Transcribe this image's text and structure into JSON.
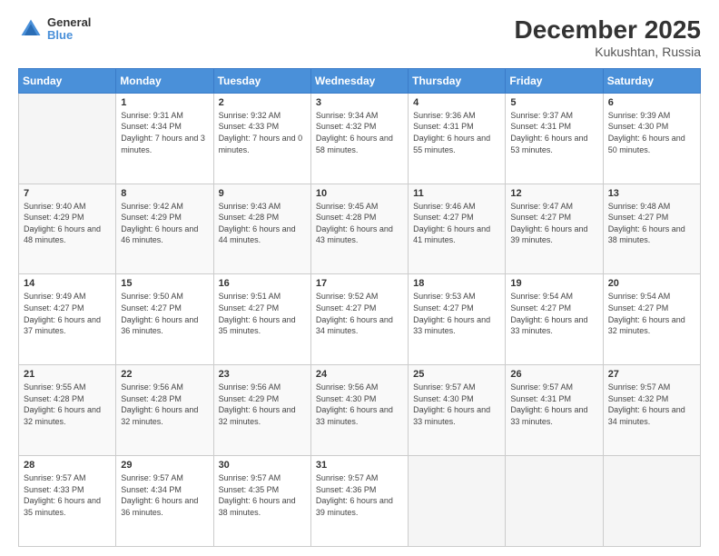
{
  "logo": {
    "text_top": "General",
    "text_bottom": "Blue"
  },
  "title": "December 2025",
  "subtitle": "Kukushtan, Russia",
  "days_header": [
    "Sunday",
    "Monday",
    "Tuesday",
    "Wednesday",
    "Thursday",
    "Friday",
    "Saturday"
  ],
  "weeks": [
    [
      {
        "day": "",
        "sunrise": "",
        "sunset": "",
        "daylight": ""
      },
      {
        "day": "1",
        "sunrise": "Sunrise: 9:31 AM",
        "sunset": "Sunset: 4:34 PM",
        "daylight": "Daylight: 7 hours and 3 minutes."
      },
      {
        "day": "2",
        "sunrise": "Sunrise: 9:32 AM",
        "sunset": "Sunset: 4:33 PM",
        "daylight": "Daylight: 7 hours and 0 minutes."
      },
      {
        "day": "3",
        "sunrise": "Sunrise: 9:34 AM",
        "sunset": "Sunset: 4:32 PM",
        "daylight": "Daylight: 6 hours and 58 minutes."
      },
      {
        "day": "4",
        "sunrise": "Sunrise: 9:36 AM",
        "sunset": "Sunset: 4:31 PM",
        "daylight": "Daylight: 6 hours and 55 minutes."
      },
      {
        "day": "5",
        "sunrise": "Sunrise: 9:37 AM",
        "sunset": "Sunset: 4:31 PM",
        "daylight": "Daylight: 6 hours and 53 minutes."
      },
      {
        "day": "6",
        "sunrise": "Sunrise: 9:39 AM",
        "sunset": "Sunset: 4:30 PM",
        "daylight": "Daylight: 6 hours and 50 minutes."
      }
    ],
    [
      {
        "day": "7",
        "sunrise": "Sunrise: 9:40 AM",
        "sunset": "Sunset: 4:29 PM",
        "daylight": "Daylight: 6 hours and 48 minutes."
      },
      {
        "day": "8",
        "sunrise": "Sunrise: 9:42 AM",
        "sunset": "Sunset: 4:29 PM",
        "daylight": "Daylight: 6 hours and 46 minutes."
      },
      {
        "day": "9",
        "sunrise": "Sunrise: 9:43 AM",
        "sunset": "Sunset: 4:28 PM",
        "daylight": "Daylight: 6 hours and 44 minutes."
      },
      {
        "day": "10",
        "sunrise": "Sunrise: 9:45 AM",
        "sunset": "Sunset: 4:28 PM",
        "daylight": "Daylight: 6 hours and 43 minutes."
      },
      {
        "day": "11",
        "sunrise": "Sunrise: 9:46 AM",
        "sunset": "Sunset: 4:27 PM",
        "daylight": "Daylight: 6 hours and 41 minutes."
      },
      {
        "day": "12",
        "sunrise": "Sunrise: 9:47 AM",
        "sunset": "Sunset: 4:27 PM",
        "daylight": "Daylight: 6 hours and 39 minutes."
      },
      {
        "day": "13",
        "sunrise": "Sunrise: 9:48 AM",
        "sunset": "Sunset: 4:27 PM",
        "daylight": "Daylight: 6 hours and 38 minutes."
      }
    ],
    [
      {
        "day": "14",
        "sunrise": "Sunrise: 9:49 AM",
        "sunset": "Sunset: 4:27 PM",
        "daylight": "Daylight: 6 hours and 37 minutes."
      },
      {
        "day": "15",
        "sunrise": "Sunrise: 9:50 AM",
        "sunset": "Sunset: 4:27 PM",
        "daylight": "Daylight: 6 hours and 36 minutes."
      },
      {
        "day": "16",
        "sunrise": "Sunrise: 9:51 AM",
        "sunset": "Sunset: 4:27 PM",
        "daylight": "Daylight: 6 hours and 35 minutes."
      },
      {
        "day": "17",
        "sunrise": "Sunrise: 9:52 AM",
        "sunset": "Sunset: 4:27 PM",
        "daylight": "Daylight: 6 hours and 34 minutes."
      },
      {
        "day": "18",
        "sunrise": "Sunrise: 9:53 AM",
        "sunset": "Sunset: 4:27 PM",
        "daylight": "Daylight: 6 hours and 33 minutes."
      },
      {
        "day": "19",
        "sunrise": "Sunrise: 9:54 AM",
        "sunset": "Sunset: 4:27 PM",
        "daylight": "Daylight: 6 hours and 33 minutes."
      },
      {
        "day": "20",
        "sunrise": "Sunrise: 9:54 AM",
        "sunset": "Sunset: 4:27 PM",
        "daylight": "Daylight: 6 hours and 32 minutes."
      }
    ],
    [
      {
        "day": "21",
        "sunrise": "Sunrise: 9:55 AM",
        "sunset": "Sunset: 4:28 PM",
        "daylight": "Daylight: 6 hours and 32 minutes."
      },
      {
        "day": "22",
        "sunrise": "Sunrise: 9:56 AM",
        "sunset": "Sunset: 4:28 PM",
        "daylight": "Daylight: 6 hours and 32 minutes."
      },
      {
        "day": "23",
        "sunrise": "Sunrise: 9:56 AM",
        "sunset": "Sunset: 4:29 PM",
        "daylight": "Daylight: 6 hours and 32 minutes."
      },
      {
        "day": "24",
        "sunrise": "Sunrise: 9:56 AM",
        "sunset": "Sunset: 4:30 PM",
        "daylight": "Daylight: 6 hours and 33 minutes."
      },
      {
        "day": "25",
        "sunrise": "Sunrise: 9:57 AM",
        "sunset": "Sunset: 4:30 PM",
        "daylight": "Daylight: 6 hours and 33 minutes."
      },
      {
        "day": "26",
        "sunrise": "Sunrise: 9:57 AM",
        "sunset": "Sunset: 4:31 PM",
        "daylight": "Daylight: 6 hours and 33 minutes."
      },
      {
        "day": "27",
        "sunrise": "Sunrise: 9:57 AM",
        "sunset": "Sunset: 4:32 PM",
        "daylight": "Daylight: 6 hours and 34 minutes."
      }
    ],
    [
      {
        "day": "28",
        "sunrise": "Sunrise: 9:57 AM",
        "sunset": "Sunset: 4:33 PM",
        "daylight": "Daylight: 6 hours and 35 minutes."
      },
      {
        "day": "29",
        "sunrise": "Sunrise: 9:57 AM",
        "sunset": "Sunset: 4:34 PM",
        "daylight": "Daylight: 6 hours and 36 minutes."
      },
      {
        "day": "30",
        "sunrise": "Sunrise: 9:57 AM",
        "sunset": "Sunset: 4:35 PM",
        "daylight": "Daylight: 6 hours and 38 minutes."
      },
      {
        "day": "31",
        "sunrise": "Sunrise: 9:57 AM",
        "sunset": "Sunset: 4:36 PM",
        "daylight": "Daylight: 6 hours and 39 minutes."
      },
      {
        "day": "",
        "sunrise": "",
        "sunset": "",
        "daylight": ""
      },
      {
        "day": "",
        "sunrise": "",
        "sunset": "",
        "daylight": ""
      },
      {
        "day": "",
        "sunrise": "",
        "sunset": "",
        "daylight": ""
      }
    ]
  ]
}
